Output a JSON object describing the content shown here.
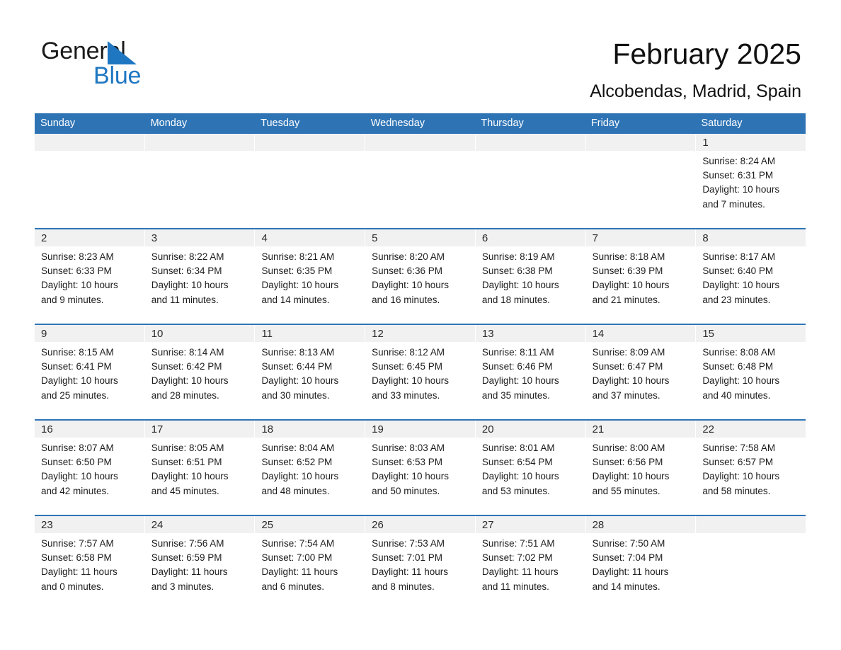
{
  "brand": {
    "name_part1": "General",
    "name_part2": "Blue",
    "triangle_color": "#1f77c2",
    "text_color": "#1a1a1a"
  },
  "header": {
    "title": "February 2025",
    "subtitle": "Alcobendas, Madrid, Spain",
    "accent_color": "#2e74b5",
    "band_color": "#f1f1f1"
  },
  "weekday_headers": [
    "Sunday",
    "Monday",
    "Tuesday",
    "Wednesday",
    "Thursday",
    "Friday",
    "Saturday"
  ],
  "labels": {
    "sunrise_prefix": "Sunrise: ",
    "sunset_prefix": "Sunset: ",
    "daylight_prefix": "Daylight: "
  },
  "weeks": [
    {
      "days": [
        {
          "date": "",
          "sunrise": "",
          "sunset": "",
          "daylight_line1": "",
          "daylight_line2": "",
          "empty": true
        },
        {
          "date": "",
          "sunrise": "",
          "sunset": "",
          "daylight_line1": "",
          "daylight_line2": "",
          "empty": true
        },
        {
          "date": "",
          "sunrise": "",
          "sunset": "",
          "daylight_line1": "",
          "daylight_line2": "",
          "empty": true
        },
        {
          "date": "",
          "sunrise": "",
          "sunset": "",
          "daylight_line1": "",
          "daylight_line2": "",
          "empty": true
        },
        {
          "date": "",
          "sunrise": "",
          "sunset": "",
          "daylight_line1": "",
          "daylight_line2": "",
          "empty": true
        },
        {
          "date": "",
          "sunrise": "",
          "sunset": "",
          "daylight_line1": "",
          "daylight_line2": "",
          "empty": true
        },
        {
          "date": "1",
          "sunrise": "Sunrise: 8:24 AM",
          "sunset": "Sunset: 6:31 PM",
          "daylight_line1": "Daylight: 10 hours",
          "daylight_line2": "and 7 minutes.",
          "empty": false
        }
      ]
    },
    {
      "days": [
        {
          "date": "2",
          "sunrise": "Sunrise: 8:23 AM",
          "sunset": "Sunset: 6:33 PM",
          "daylight_line1": "Daylight: 10 hours",
          "daylight_line2": "and 9 minutes.",
          "empty": false
        },
        {
          "date": "3",
          "sunrise": "Sunrise: 8:22 AM",
          "sunset": "Sunset: 6:34 PM",
          "daylight_line1": "Daylight: 10 hours",
          "daylight_line2": "and 11 minutes.",
          "empty": false
        },
        {
          "date": "4",
          "sunrise": "Sunrise: 8:21 AM",
          "sunset": "Sunset: 6:35 PM",
          "daylight_line1": "Daylight: 10 hours",
          "daylight_line2": "and 14 minutes.",
          "empty": false
        },
        {
          "date": "5",
          "sunrise": "Sunrise: 8:20 AM",
          "sunset": "Sunset: 6:36 PM",
          "daylight_line1": "Daylight: 10 hours",
          "daylight_line2": "and 16 minutes.",
          "empty": false
        },
        {
          "date": "6",
          "sunrise": "Sunrise: 8:19 AM",
          "sunset": "Sunset: 6:38 PM",
          "daylight_line1": "Daylight: 10 hours",
          "daylight_line2": "and 18 minutes.",
          "empty": false
        },
        {
          "date": "7",
          "sunrise": "Sunrise: 8:18 AM",
          "sunset": "Sunset: 6:39 PM",
          "daylight_line1": "Daylight: 10 hours",
          "daylight_line2": "and 21 minutes.",
          "empty": false
        },
        {
          "date": "8",
          "sunrise": "Sunrise: 8:17 AM",
          "sunset": "Sunset: 6:40 PM",
          "daylight_line1": "Daylight: 10 hours",
          "daylight_line2": "and 23 minutes.",
          "empty": false
        }
      ]
    },
    {
      "days": [
        {
          "date": "9",
          "sunrise": "Sunrise: 8:15 AM",
          "sunset": "Sunset: 6:41 PM",
          "daylight_line1": "Daylight: 10 hours",
          "daylight_line2": "and 25 minutes.",
          "empty": false
        },
        {
          "date": "10",
          "sunrise": "Sunrise: 8:14 AM",
          "sunset": "Sunset: 6:42 PM",
          "daylight_line1": "Daylight: 10 hours",
          "daylight_line2": "and 28 minutes.",
          "empty": false
        },
        {
          "date": "11",
          "sunrise": "Sunrise: 8:13 AM",
          "sunset": "Sunset: 6:44 PM",
          "daylight_line1": "Daylight: 10 hours",
          "daylight_line2": "and 30 minutes.",
          "empty": false
        },
        {
          "date": "12",
          "sunrise": "Sunrise: 8:12 AM",
          "sunset": "Sunset: 6:45 PM",
          "daylight_line1": "Daylight: 10 hours",
          "daylight_line2": "and 33 minutes.",
          "empty": false
        },
        {
          "date": "13",
          "sunrise": "Sunrise: 8:11 AM",
          "sunset": "Sunset: 6:46 PM",
          "daylight_line1": "Daylight: 10 hours",
          "daylight_line2": "and 35 minutes.",
          "empty": false
        },
        {
          "date": "14",
          "sunrise": "Sunrise: 8:09 AM",
          "sunset": "Sunset: 6:47 PM",
          "daylight_line1": "Daylight: 10 hours",
          "daylight_line2": "and 37 minutes.",
          "empty": false
        },
        {
          "date": "15",
          "sunrise": "Sunrise: 8:08 AM",
          "sunset": "Sunset: 6:48 PM",
          "daylight_line1": "Daylight: 10 hours",
          "daylight_line2": "and 40 minutes.",
          "empty": false
        }
      ]
    },
    {
      "days": [
        {
          "date": "16",
          "sunrise": "Sunrise: 8:07 AM",
          "sunset": "Sunset: 6:50 PM",
          "daylight_line1": "Daylight: 10 hours",
          "daylight_line2": "and 42 minutes.",
          "empty": false
        },
        {
          "date": "17",
          "sunrise": "Sunrise: 8:05 AM",
          "sunset": "Sunset: 6:51 PM",
          "daylight_line1": "Daylight: 10 hours",
          "daylight_line2": "and 45 minutes.",
          "empty": false
        },
        {
          "date": "18",
          "sunrise": "Sunrise: 8:04 AM",
          "sunset": "Sunset: 6:52 PM",
          "daylight_line1": "Daylight: 10 hours",
          "daylight_line2": "and 48 minutes.",
          "empty": false
        },
        {
          "date": "19",
          "sunrise": "Sunrise: 8:03 AM",
          "sunset": "Sunset: 6:53 PM",
          "daylight_line1": "Daylight: 10 hours",
          "daylight_line2": "and 50 minutes.",
          "empty": false
        },
        {
          "date": "20",
          "sunrise": "Sunrise: 8:01 AM",
          "sunset": "Sunset: 6:54 PM",
          "daylight_line1": "Daylight: 10 hours",
          "daylight_line2": "and 53 minutes.",
          "empty": false
        },
        {
          "date": "21",
          "sunrise": "Sunrise: 8:00 AM",
          "sunset": "Sunset: 6:56 PM",
          "daylight_line1": "Daylight: 10 hours",
          "daylight_line2": "and 55 minutes.",
          "empty": false
        },
        {
          "date": "22",
          "sunrise": "Sunrise: 7:58 AM",
          "sunset": "Sunset: 6:57 PM",
          "daylight_line1": "Daylight: 10 hours",
          "daylight_line2": "and 58 minutes.",
          "empty": false
        }
      ]
    },
    {
      "days": [
        {
          "date": "23",
          "sunrise": "Sunrise: 7:57 AM",
          "sunset": "Sunset: 6:58 PM",
          "daylight_line1": "Daylight: 11 hours",
          "daylight_line2": "and 0 minutes.",
          "empty": false
        },
        {
          "date": "24",
          "sunrise": "Sunrise: 7:56 AM",
          "sunset": "Sunset: 6:59 PM",
          "daylight_line1": "Daylight: 11 hours",
          "daylight_line2": "and 3 minutes.",
          "empty": false
        },
        {
          "date": "25",
          "sunrise": "Sunrise: 7:54 AM",
          "sunset": "Sunset: 7:00 PM",
          "daylight_line1": "Daylight: 11 hours",
          "daylight_line2": "and 6 minutes.",
          "empty": false
        },
        {
          "date": "26",
          "sunrise": "Sunrise: 7:53 AM",
          "sunset": "Sunset: 7:01 PM",
          "daylight_line1": "Daylight: 11 hours",
          "daylight_line2": "and 8 minutes.",
          "empty": false
        },
        {
          "date": "27",
          "sunrise": "Sunrise: 7:51 AM",
          "sunset": "Sunset: 7:02 PM",
          "daylight_line1": "Daylight: 11 hours",
          "daylight_line2": "and 11 minutes.",
          "empty": false
        },
        {
          "date": "28",
          "sunrise": "Sunrise: 7:50 AM",
          "sunset": "Sunset: 7:04 PM",
          "daylight_line1": "Daylight: 11 hours",
          "daylight_line2": "and 14 minutes.",
          "empty": false
        },
        {
          "date": "",
          "sunrise": "",
          "sunset": "",
          "daylight_line1": "",
          "daylight_line2": "",
          "empty": true
        }
      ]
    }
  ]
}
